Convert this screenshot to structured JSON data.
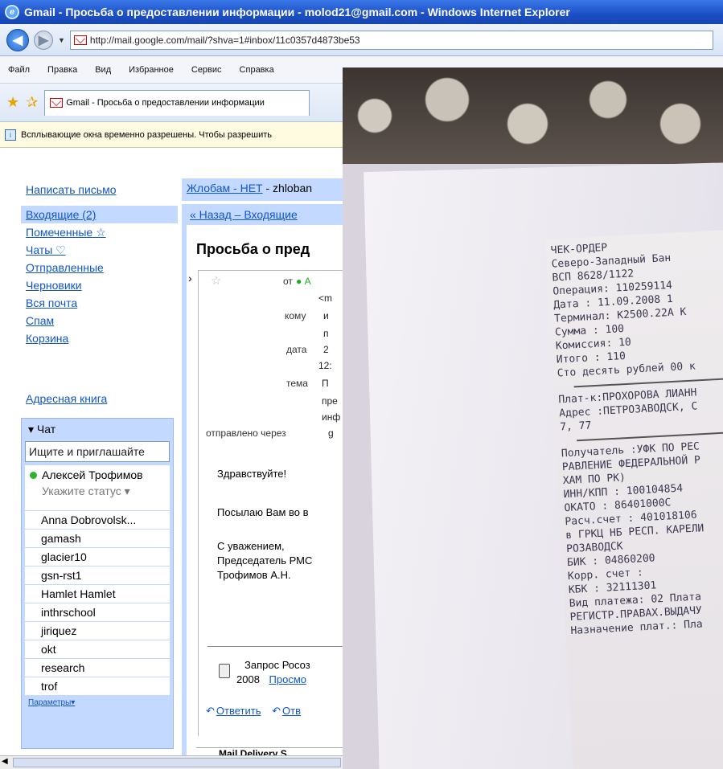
{
  "window": {
    "title": "Gmail - Просьба о предоставлении информации - molod21@gmail.com - Windows Internet Explorer",
    "url": "http://mail.google.com/mail/?shva=1#inbox/11c0357d4873be53"
  },
  "menu": [
    "Файл",
    "Правка",
    "Вид",
    "Избранное",
    "Сервис",
    "Справка"
  ],
  "tab": {
    "title": "Gmail - Просьба о предоставлении информации"
  },
  "infobar": {
    "text": "Всплывающие окна временно разрешены. Чтобы разрешить"
  },
  "sidebar": {
    "compose": "Написать письмо",
    "items": [
      {
        "label": "Входящие (2)"
      },
      {
        "label": "Помеченные ☆"
      },
      {
        "label": "Чаты ♡"
      },
      {
        "label": "Отправленные"
      },
      {
        "label": "Черновики"
      },
      {
        "label": "Вся почта"
      },
      {
        "label": "Спам"
      },
      {
        "label": "Корзина"
      }
    ],
    "address_book": "Адресная книга"
  },
  "chat": {
    "header": "▾ Чат",
    "search_placeholder": "Ищите и приглашайте",
    "me_name": "Алексей Трофимов",
    "me_status": "Укажите статус ▾",
    "contacts": [
      "Anna Dobrovolsk...",
      "gamash",
      "glacier10",
      "gsn-rst1",
      "Hamlet Hamlet",
      "inthrschool",
      "jiriquez",
      "okt",
      "research",
      "trof"
    ],
    "options": "Параметры▾"
  },
  "message": {
    "sender_name": "Жлобам - НЕТ",
    "sender_suffix": " - zhloban",
    "back_link": "« Назад – Входящие",
    "subject": "Просьба о пред",
    "from_label": "от",
    "from_value": "● А",
    "addr_value": "<m",
    "to_label": "кому",
    "to_value1": "и",
    "to_value2": "п",
    "date_label": "дата",
    "date_value1": "2",
    "date_value2": "12:",
    "topic_label": "тема",
    "topic_value1": "П",
    "topic_value2": "пре",
    "topic_value3": "инф",
    "via_label": "отправлено через",
    "via_value": "g",
    "greeting": "Здравствуйте!",
    "body": "Посылаю Вам во в",
    "sign1": "С уважением,",
    "sign2": "Председатель РМС",
    "sign3": "Трофимов А.Н.",
    "attach_name": "Запрос Росоз",
    "attach_year": "2008",
    "attach_view": "Просмо",
    "reply": "Ответить",
    "reply_all": "Отв",
    "next_sender": "Mail Delivery S"
  },
  "receipt": {
    "lines": [
      "          ЧЕК-ОРДЕР",
      "  Северо-Западный Бан",
      "ВСП 8628/1122",
      "Операция: 110259114",
      "Дата    : 11.09.2008 1",
      "Терминал: K2500.22A  К",
      "Сумма   :          100",
      "Комиссия:           10",
      "Итого   :          110",
      "Сто десять рублей 00 к",
      "",
      "Плат-к:ПРОХОРОВА ЛИАНН",
      "Адрес :ПЕТРОЗАВОДСК, С",
      "7, 77",
      "",
      "Получатель :УФК ПО РЕС",
      "РАВЛЕНИЕ ФЕДЕРАЛЬНОЙ Р",
      "ХАМ ПО РК)",
      "ИНН/КПП   : 100104854",
      "ОКАТО     : 86401000C",
      "Расч.счет : 401018106",
      "в ГРКЦ НБ РЕСП. КАРЕЛИ",
      "РОЗАВОДСК",
      "БИК       : 04860200",
      "Корр. счет :",
      "КБК       : 32111301",
      "Вид платежа: 02 Плата",
      "РЕГИСТР.ПРАВАХ.ВЫДАЧУ",
      "Назначение плат.: Пла"
    ]
  }
}
